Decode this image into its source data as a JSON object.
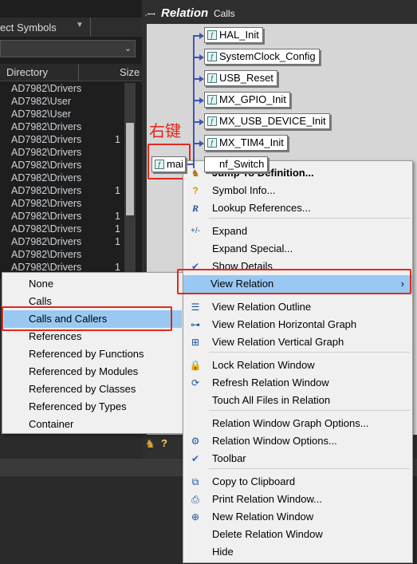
{
  "symbol_panel": {
    "title": "ect Symbols",
    "header": {
      "directory": "Directory",
      "size": "Size"
    },
    "rows": [
      {
        "dir": "AD7982\\Drivers",
        "size": ""
      },
      {
        "dir": "AD7982\\User",
        "size": ""
      },
      {
        "dir": "AD7982\\User",
        "size": ""
      },
      {
        "dir": "AD7982\\Drivers",
        "size": ""
      },
      {
        "dir": "AD7982\\Drivers",
        "size": "1"
      },
      {
        "dir": "AD7982\\Drivers",
        "size": ""
      },
      {
        "dir": "AD7982\\Drivers",
        "size": ""
      },
      {
        "dir": "AD7982\\Drivers",
        "size": ""
      },
      {
        "dir": "AD7982\\Drivers",
        "size": "1"
      },
      {
        "dir": "AD7982\\Drivers",
        "size": ""
      },
      {
        "dir": "AD7982\\Drivers",
        "size": "1"
      },
      {
        "dir": "AD7982\\Drivers",
        "size": "1"
      },
      {
        "dir": "AD7982\\Drivers",
        "size": "1"
      },
      {
        "dir": "AD7982\\Drivers",
        "size": ""
      },
      {
        "dir": "AD7982\\Drivers",
        "size": "1"
      }
    ]
  },
  "relation": {
    "title_bold": "Relation",
    "title_sub": "Calls",
    "main_node": "mai",
    "callees": [
      "HAL_Init",
      "SystemClock_Config",
      "USB_Reset",
      "MX_GPIO_Init",
      "MX_USB_DEVICE_Init",
      "MX_TIM4_Init"
    ],
    "partial_node": "nf_Switch",
    "annotation": "右键"
  },
  "context_menu": {
    "items": [
      {
        "label": "Jump To Definition...",
        "icon": "jump-icon"
      },
      {
        "label": "Symbol Info...",
        "icon": "info-icon"
      },
      {
        "label": "Lookup References...",
        "icon": "lookup-r-icon"
      },
      {
        "label": "Expand",
        "icon": "expand-icon"
      },
      {
        "label": "Expand Special...",
        "icon": ""
      },
      {
        "label": "Show Details",
        "icon": "check-icon"
      },
      {
        "label": "View Relation",
        "icon": ""
      },
      {
        "label": "View Relation Outline",
        "icon": "outline-icon"
      },
      {
        "label": "View Relation Horizontal Graph",
        "icon": "horizontal-graph-icon"
      },
      {
        "label": "View Relation Vertical Graph",
        "icon": "vertical-graph-icon"
      },
      {
        "label": "Lock Relation Window",
        "icon": "lock-icon"
      },
      {
        "label": "Refresh Relation Window",
        "icon": "refresh-icon"
      },
      {
        "label": "Touch All Files in Relation",
        "icon": ""
      },
      {
        "label": "Relation Window Graph Options...",
        "icon": ""
      },
      {
        "label": "Relation Window Options...",
        "icon": "gear-icon"
      },
      {
        "label": "Toolbar",
        "icon": "check-icon"
      },
      {
        "label": "Copy to Clipboard",
        "icon": "copy-icon"
      },
      {
        "label": "Print Relation Window...",
        "icon": "print-icon"
      },
      {
        "label": "New Relation Window",
        "icon": "new-window-icon"
      },
      {
        "label": "Delete Relation Window",
        "icon": ""
      },
      {
        "label": "Hide",
        "icon": ""
      }
    ]
  },
  "submenu": {
    "items": [
      "None",
      "Calls",
      "Calls and Callers",
      "References",
      "Referenced by Functions",
      "Referenced by Modules",
      "Referenced by Classes",
      "Referenced by Types",
      "Container"
    ]
  },
  "colors": {
    "highlight": "#99c9f3",
    "annotation": "#e0281e",
    "link": "#3c55b5"
  }
}
